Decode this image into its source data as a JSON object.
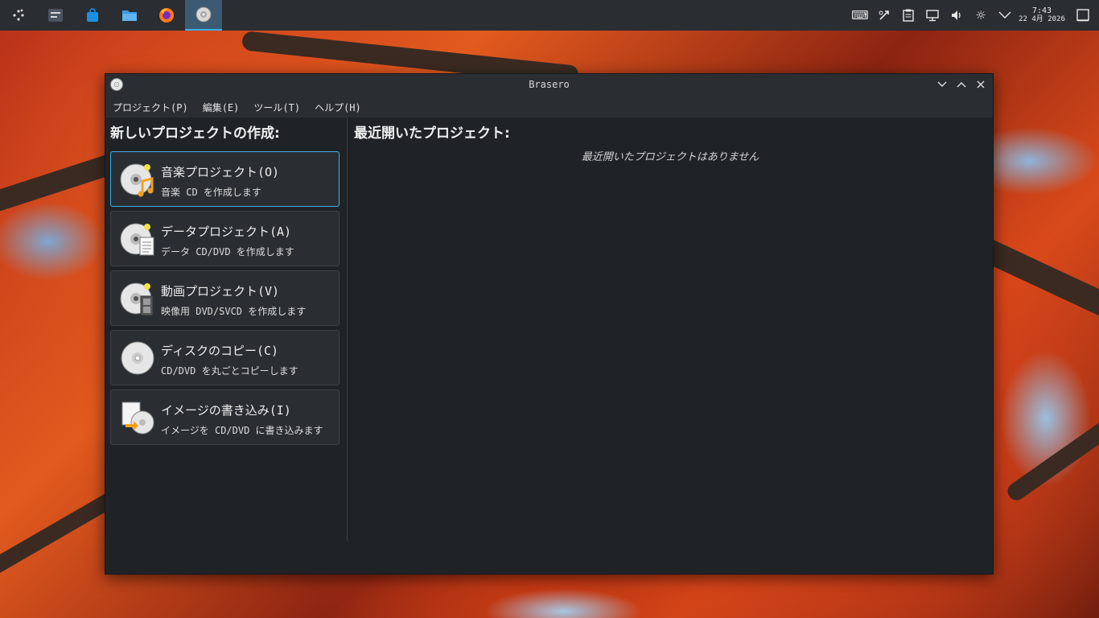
{
  "taskbar": {
    "apps": [
      {
        "name": "launcher-icon",
        "active": false
      },
      {
        "name": "system-settings-icon",
        "active": false
      },
      {
        "name": "software-store-icon",
        "active": false
      },
      {
        "name": "file-manager-icon",
        "active": false
      },
      {
        "name": "firefox-icon",
        "active": false
      },
      {
        "name": "brasero-icon",
        "active": true
      }
    ],
    "clock": {
      "time": "7:43",
      "date": "22 4月 2026"
    }
  },
  "window": {
    "title": "Brasero"
  },
  "menu": {
    "project": "プロジェクト(P)",
    "edit": "編集(E)",
    "tools": "ツール(T)",
    "help": "ヘルプ(H)"
  },
  "new_project": {
    "heading": "新しいプロジェクトの作成:",
    "items": [
      {
        "label": "音楽プロジェクト(O)",
        "desc": "音楽 CD を作成します",
        "icon": "audio-disc-icon"
      },
      {
        "label": "データプロジェクト(A)",
        "desc": "データ CD/DVD を作成します",
        "icon": "data-disc-icon"
      },
      {
        "label": "動画プロジェクト(V)",
        "desc": "映像用 DVD/SVCD を作成します",
        "icon": "video-disc-icon"
      },
      {
        "label": "ディスクのコピー(C)",
        "desc": "CD/DVD を丸ごとコピーします",
        "icon": "disc-copy-icon"
      },
      {
        "label": "イメージの書き込み(I)",
        "desc": "イメージを CD/DVD に書き込みます",
        "icon": "image-burn-icon"
      }
    ]
  },
  "recent": {
    "heading": "最近開いたプロジェクト:",
    "empty": "最近開いたプロジェクトはありません"
  },
  "colors": {
    "accent": "#3daee9",
    "window_bg": "#202326",
    "taskbar_bg": "#2a2d31"
  }
}
